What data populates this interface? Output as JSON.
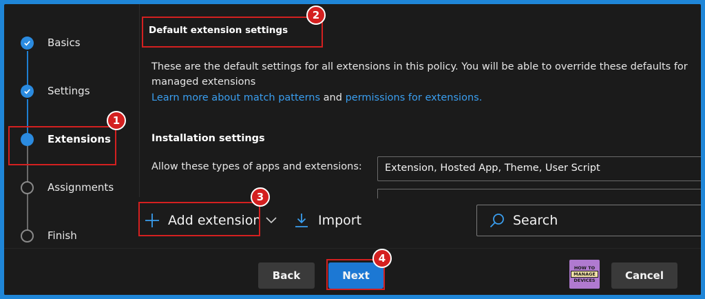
{
  "steps": [
    {
      "label": "Basics",
      "state": "done"
    },
    {
      "label": "Settings",
      "state": "done"
    },
    {
      "label": "Extensions",
      "state": "current"
    },
    {
      "label": "Assignments",
      "state": "todo"
    },
    {
      "label": "Finish",
      "state": "todo"
    }
  ],
  "content": {
    "section_title": "Default extension settings",
    "description": "These are the default settings for all extensions in this policy. You will be able to override these defaults for managed extensions",
    "link_match_patterns": "Learn more about match patterns",
    "link_and": "and",
    "link_permissions": "permissions for extensions.",
    "install_title": "Installation settings",
    "allow_label": "Allow these types of apps and extensions:",
    "allow_value": "Extension, Hosted App, Theme, User Script"
  },
  "toolbar": {
    "add_label": "Add extension",
    "import_label": "Import",
    "search_placeholder": "Search"
  },
  "footer": {
    "back_label": "Back",
    "next_label": "Next",
    "cancel_label": "Cancel",
    "logo_top": "HOW TO",
    "logo_mid": "MANAGE",
    "logo_bottom": "DEVICES"
  },
  "annotations": [
    "1",
    "2",
    "3",
    "4"
  ],
  "colors": {
    "accent": "#1c78d4",
    "link": "#3a9eef",
    "annotation": "#d42020",
    "frame": "#1f86d8"
  }
}
